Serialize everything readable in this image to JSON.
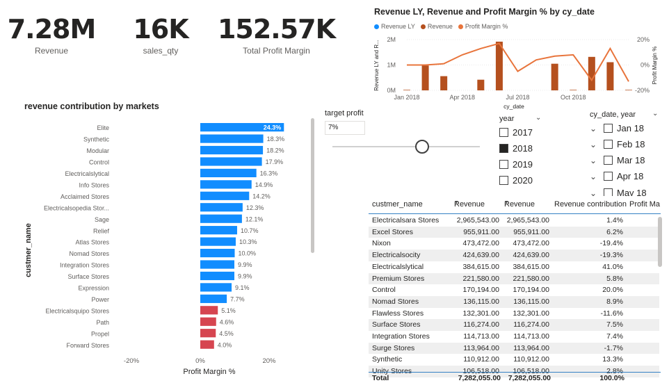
{
  "kpis": [
    {
      "value": "7.28M",
      "label": "Revenue"
    },
    {
      "value": "16K",
      "label": "sales_qty"
    },
    {
      "value": "152.57K",
      "label": "Total Profit Margin"
    }
  ],
  "combo": {
    "title": "Revenue LY, Revenue and Profit Margin % by cy_date",
    "legend": [
      "Revenue LY",
      "Revenue",
      "Profit Margin %"
    ],
    "colors": {
      "revenue_ly": "#118dff",
      "revenue": "#b5501e",
      "profit_margin": "#e8743b"
    },
    "left_axis_title": "Revenue LY and R...",
    "right_axis_title": "Profit Margin %",
    "x_axis_title": "cy_date",
    "left_ticks": [
      "2M",
      "1M",
      "0M"
    ],
    "right_ticks": [
      "20%",
      "0%",
      "-20%"
    ],
    "x_ticks": [
      "Jan 2018",
      "Apr 2018",
      "Jul 2018",
      "Oct 2018"
    ]
  },
  "bar_chart": {
    "title": "revenue contribution by markets",
    "y_axis_title": "custmer_name",
    "x_axis_title": "Profit Margin %",
    "x_ticks": [
      "-20%",
      "0%",
      "20%"
    ]
  },
  "chart_data": [
    {
      "type": "bar",
      "title": "revenue contribution by markets",
      "xlabel": "Profit Margin %",
      "ylabel": "custmer_name",
      "xlim": [
        -20,
        25
      ],
      "categories": [
        "Elite",
        "Synthetic",
        "Modular",
        "Control",
        "Electricalslytical",
        "Info Stores",
        "Acclaimed Stores",
        "Electricalsopedia Stor...",
        "Sage",
        "Relief",
        "Atlas Stores",
        "Nomad Stores",
        "Integration Stores",
        "Surface Stores",
        "Expression",
        "Power",
        "Electricalsquipo Stores",
        "Path",
        "Propel",
        "Forward Stores"
      ],
      "values": [
        24.3,
        18.3,
        18.2,
        17.9,
        16.3,
        14.9,
        14.2,
        12.3,
        12.1,
        10.7,
        10.3,
        10.0,
        9.9,
        9.9,
        9.1,
        7.7,
        5.1,
        4.6,
        4.5,
        4.0
      ],
      "labels": [
        "24.3%",
        "18.3%",
        "18.2%",
        "17.9%",
        "16.3%",
        "14.9%",
        "14.2%",
        "12.3%",
        "12.1%",
        "10.7%",
        "10.3%",
        "10.0%",
        "9.9%",
        "9.9%",
        "9.1%",
        "7.7%",
        "5.1%",
        "4.6%",
        "4.5%",
        "4.0%"
      ],
      "colors": {
        "above_target": "#118dff",
        "below_target": "#d64550",
        "highlight": "#118dff"
      },
      "threshold": 7
    },
    {
      "type": "bar",
      "title": "Revenue LY, Revenue and Profit Margin % by cy_date",
      "xlabel": "cy_date",
      "ylabel": "Revenue LY and R...",
      "y2label": "Profit Margin %",
      "ylim": [
        0,
        2000000
      ],
      "y2lim": [
        -20,
        20
      ],
      "categories": [
        "Jan 2018",
        "Feb 2018",
        "Mar 2018",
        "Apr 2018",
        "May 2018",
        "Jun 2018",
        "Jul 2018",
        "Aug 2018",
        "Sep 2018",
        "Oct 2018",
        "Nov 2018",
        "Dec 2018"
      ],
      "series": [
        {
          "name": "Revenue",
          "kind": "bar",
          "values": [
            20000,
            980000,
            560000,
            0,
            420000,
            1920000,
            0,
            0,
            1050000,
            20000,
            1320000,
            1110000,
            20000
          ]
        },
        {
          "name": "Profit Margin %",
          "kind": "line",
          "values": [
            0,
            0,
            1,
            8,
            13,
            17,
            -5,
            4,
            7,
            8,
            -12,
            13,
            -13
          ]
        }
      ],
      "x": [
        "Jan 2018",
        "Feb 2018",
        "Mar 2018",
        "Apr 2018",
        "May 2018",
        "Jun 2018",
        "Jul 2018",
        "Aug 2018",
        "Sep 2018",
        "Oct 2018",
        "Nov 2018",
        "Dec 2018",
        "Jan 2019"
      ]
    }
  ],
  "target": {
    "label": "target profit",
    "value": "7%"
  },
  "year_slicer": {
    "title": "year",
    "items": [
      {
        "label": "2017",
        "checked": false
      },
      {
        "label": "2018",
        "checked": true
      },
      {
        "label": "2019",
        "checked": false
      },
      {
        "label": "2020",
        "checked": false
      }
    ]
  },
  "date_slicer": {
    "title": "cy_date, year",
    "items": [
      "Jan 18",
      "Feb 18",
      "Mar 18",
      "Apr 18",
      "May 18"
    ]
  },
  "table": {
    "headers": [
      "custmer_name",
      "Revenue",
      "Revenue",
      "Revenue contribution",
      "Profit Ma"
    ],
    "rows": [
      [
        "Electricalsara Stores",
        "2,965,543.00",
        "2,965,543.00",
        "1.4%"
      ],
      [
        "Excel Stores",
        "955,911.00",
        "955,911.00",
        "6.2%"
      ],
      [
        "Nixon",
        "473,472.00",
        "473,472.00",
        "-19.4%"
      ],
      [
        "Electricalsocity",
        "424,639.00",
        "424,639.00",
        "-19.3%"
      ],
      [
        "Electricalslytical",
        "384,615.00",
        "384,615.00",
        "41.0%"
      ],
      [
        "Premium Stores",
        "221,580.00",
        "221,580.00",
        "5.8%"
      ],
      [
        "Control",
        "170,194.00",
        "170,194.00",
        "20.0%"
      ],
      [
        "Nomad Stores",
        "136,115.00",
        "136,115.00",
        "8.9%"
      ],
      [
        "Flawless Stores",
        "132,301.00",
        "132,301.00",
        "-11.6%"
      ],
      [
        "Surface Stores",
        "116,274.00",
        "116,274.00",
        "7.5%"
      ],
      [
        "Integration Stores",
        "114,713.00",
        "114,713.00",
        "7.4%"
      ],
      [
        "Surge Stores",
        "113,964.00",
        "113,964.00",
        "-1.7%"
      ],
      [
        "Synthetic",
        "110,912.00",
        "110,912.00",
        "13.3%"
      ],
      [
        "Unity Stores",
        "106,518.00",
        "106,518.00",
        "2.8%"
      ]
    ],
    "total": [
      "Total",
      "7,282,055.00",
      "7,282,055.00",
      "100.0%"
    ]
  }
}
